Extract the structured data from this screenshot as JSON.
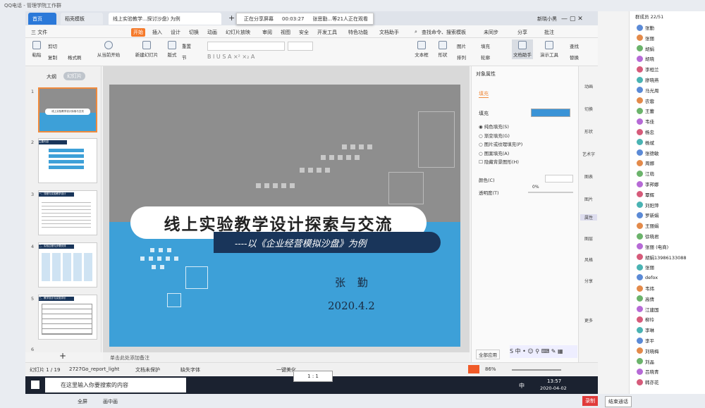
{
  "qq": {
    "title": "QQ电话 - 管理学院工作群",
    "member_header": "群成员 22/51",
    "recording_btn": "录制",
    "follow_btn": "结束通话",
    "bottom_items": [
      "全屏",
      "画中画"
    ]
  },
  "share": {
    "status": "正在分享屏幕",
    "timer": "00:03:27",
    "viewers": "张思勤...等21人正在观看"
  },
  "tabs": {
    "home": "首页",
    "template": "稻壳模板",
    "doc": "线上实验教学...探讨沙盘) 为例",
    "plus": "+",
    "user": "新晓小黑"
  },
  "menu": {
    "file": "三 文件",
    "items": [
      "开始",
      "插入",
      "设计",
      "切换",
      "动画",
      "幻灯片放映",
      "审阅",
      "视图",
      "安全",
      "开发工具",
      "特色功能",
      "文档助手"
    ],
    "search": "查找命令、搜索模板",
    "sync": "未同步",
    "share": "分享",
    "comment": "批注"
  },
  "ribbon": {
    "paste": "粘贴",
    "cut": "剪切",
    "copy": "复制",
    "format": "格式刷",
    "from_current": "从当前开始",
    "new_slide": "新建幻灯片",
    "layout": "版式",
    "section": "节",
    "reset": "重置",
    "textbox": "文本框",
    "shape": "形状",
    "arrange": "排列",
    "picture": "图片",
    "fill": "填充",
    "outline": "轮廓",
    "doc_assist": "文档助手",
    "present": "演示工具",
    "replace": "替换",
    "find": "查找",
    "select": "选择"
  },
  "left": {
    "outline_tab": "大纲",
    "slides_tab": "幻灯片",
    "add": "+",
    "numbers": [
      "1",
      "2",
      "3",
      "4",
      "5",
      "6"
    ],
    "thumb1": "线上实验教学设计探索与交流",
    "thumb2": "主要内容",
    "thumb3": "一、流程与实验教学设计",
    "thumb4": "二、实验过程与步骤安排",
    "thumb5": "三、教学设计与实验评价"
  },
  "slide": {
    "title": "线上实验教学设计探索与交流",
    "subtitle": "----以《企业经营模拟沙盘》为例",
    "author": "张 勤",
    "date": "2020.4.2"
  },
  "notes": {
    "placeholder": "单击此处添加备注"
  },
  "rpanel": {
    "title": "对象属性",
    "tab": "填充",
    "fill_label": "填充",
    "options": [
      "纯色填充(S)",
      "渐变填充(G)",
      "图片或纹理填充(P)",
      "图案填充(A)",
      "隐藏背景图形(H)"
    ],
    "color_label": "颜色(C)",
    "transparency_label": "透明度(T)",
    "transparency_value": "0%",
    "all_apply": "全部应用",
    "fill_color": "#3a93d6"
  },
  "rtool": {
    "items": [
      "动画",
      "切换",
      "形状",
      "艺术字",
      "图表",
      "图片",
      "图表",
      "属性",
      "图层",
      "风格",
      "分享",
      "更多"
    ]
  },
  "status": {
    "slide": "幻灯片 1 / 19",
    "theme": "2727Go_report_light",
    "protect": "文档未保护",
    "font": "缺失字体",
    "beautify": "一键美化",
    "ratio": "1 : 1",
    "zoom": "86%"
  },
  "taskbar": {
    "search": "在这里输入你要搜索的内容",
    "time": "13:57",
    "date": "2020-04-02",
    "lang": "中"
  },
  "members": [
    "张勤",
    "张丽",
    "胡娟",
    "胡晓",
    "李桓兰",
    "廖晓燕",
    "马光周",
    "农蓉",
    "王蕾",
    "韦佳",
    "杨忠",
    "杨斌",
    "张德敏",
    "周娜",
    "江萌",
    "李邦娜",
    "覃辉",
    "刘阳萍",
    "罗新娟",
    "王丽娟",
    "徐晓君",
    "张丽 (电商)",
    "胡娟13986133088",
    "张丽",
    "defox",
    "韦玮",
    "高倩",
    "江建国",
    "柳玲",
    "李琳",
    "李平",
    "刘晓梅",
    "刘晶",
    "吕晓青",
    "韩亦花"
  ]
}
